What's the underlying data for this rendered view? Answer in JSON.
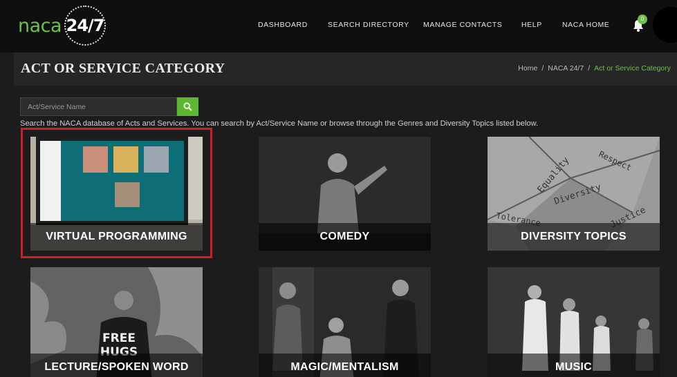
{
  "header": {
    "logo_text": "naca",
    "logo_badge": "24/7",
    "nav": [
      "DASHBOARD",
      "SEARCH DIRECTORY",
      "MANAGE CONTACTS",
      "HELP",
      "NACA HOME"
    ],
    "notification_count": "0"
  },
  "page": {
    "title": "ACT OR SERVICE CATEGORY",
    "breadcrumb": [
      "Home",
      "NACA 24/7",
      "Act or Service Category"
    ]
  },
  "search": {
    "placeholder": "Act/Service Name",
    "help_text": "Search the NACA database of Acts and Services. You can search by Act/Service Name or browse through the Genres and Diversity Topics listed below."
  },
  "categories": [
    {
      "label": "VIRTUAL PROGRAMMING",
      "selected": true
    },
    {
      "label": "COMEDY",
      "selected": false
    },
    {
      "label": "DIVERSITY TOPICS",
      "selected": false
    },
    {
      "label": "LECTURE/SPOKEN WORD",
      "selected": false
    },
    {
      "label": "MAGIC/MENTALISM",
      "selected": false
    },
    {
      "label": "MUSIC",
      "selected": false
    }
  ],
  "image_text": {
    "free_hugs": [
      "FREE",
      "HUGS"
    ],
    "diversity_words": [
      "Equality",
      "Respect",
      "Diversity",
      "Justice",
      "Tolerance"
    ]
  },
  "colors": {
    "brand_green": "#6cc04a",
    "selection_red": "#d21e22",
    "nav_bg": "#0f0f0f",
    "page_bg": "#1c1c1c"
  }
}
